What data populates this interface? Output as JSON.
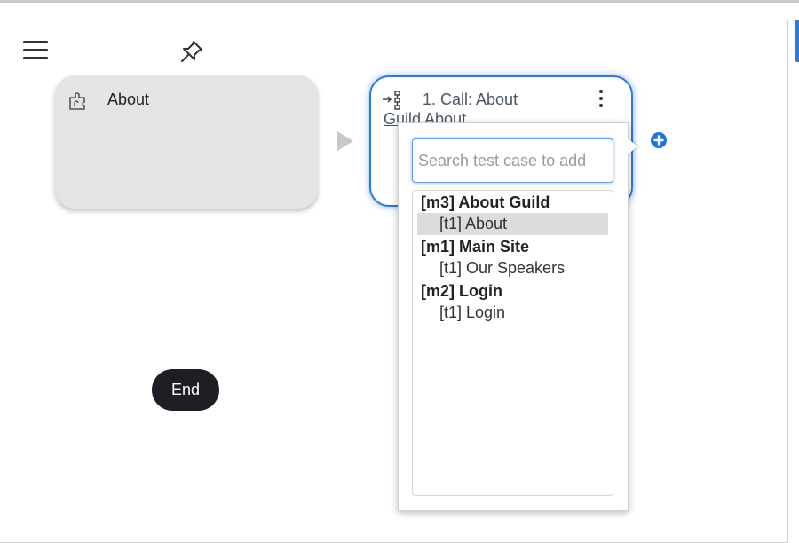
{
  "toolbar": {
    "menu_icon": "hamburger-menu-icon",
    "pin_icon": "pushpin-icon"
  },
  "steps": [
    {
      "icon": "puzzle-piece-icon",
      "label": "About"
    }
  ],
  "call_step": {
    "icon": "call-link-icon",
    "title_line1": "1. Call: About",
    "title_line2": "Guild About",
    "more_icon": "kebab-menu-icon"
  },
  "add_icon": "plus-circle-icon",
  "picker": {
    "search_placeholder": "Search test case to add",
    "groups": [
      {
        "label": "[m3] About Guild",
        "items": [
          {
            "label": "[t1] About",
            "selected": true
          }
        ]
      },
      {
        "label": "[m1] Main Site",
        "items": [
          {
            "label": "[t1] Our Speakers",
            "selected": false
          }
        ]
      },
      {
        "label": "[m2] Login",
        "items": [
          {
            "label": "[t1] Login",
            "selected": false
          }
        ]
      }
    ]
  },
  "end_node": {
    "label": "End"
  },
  "colors": {
    "accent": "#2a7ae2",
    "card_bg": "#e4e4e4",
    "end_bg": "#1d1f24",
    "selected_bg": "#dcdcdc"
  }
}
